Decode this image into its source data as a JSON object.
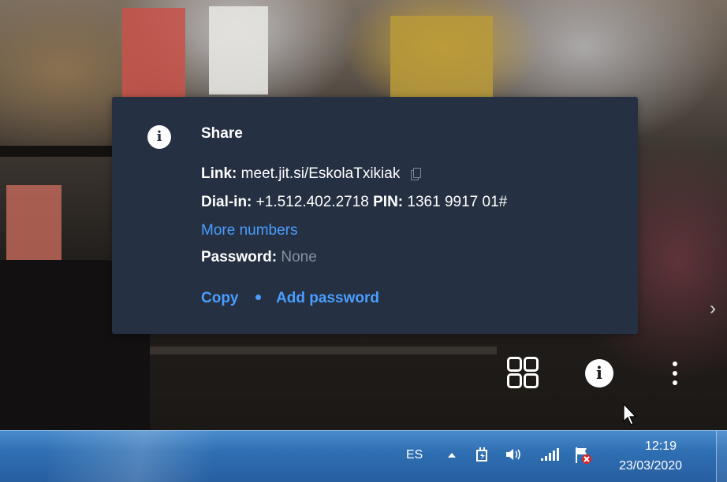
{
  "share_dialog": {
    "title": "Share",
    "link_label": "Link:",
    "link_value": "meet.jit.si/EskolaTxikiak",
    "dial_in_label": "Dial-in:",
    "dial_in_value": "+1.512.402.2718",
    "pin_label": "PIN:",
    "pin_value": "1361 9917 01#",
    "more_numbers": "More numbers",
    "password_label": "Password:",
    "password_value": "None",
    "copy_action": "Copy",
    "add_password_action": "Add password",
    "icon": "info-icon"
  },
  "toolbar": {
    "icons": [
      "tile-view-icon",
      "info-icon",
      "more-options-icon",
      "chevron-right-icon"
    ]
  },
  "taskbar": {
    "language": "ES",
    "tray_icons": [
      "show-hidden-icons-arrow",
      "power-icon",
      "volume-icon",
      "network-signal-icon",
      "action-center-flag-icon"
    ],
    "clock_time": "12:19",
    "clock_date": "23/03/2020"
  },
  "colors": {
    "popup_bg": "#253042",
    "link_blue": "#4a9eff",
    "muted_text": "#8792a3",
    "taskbar_blue": "#2f6fb3"
  }
}
